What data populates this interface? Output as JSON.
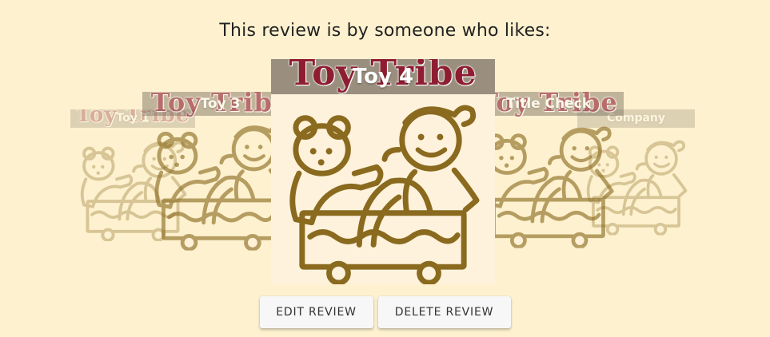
{
  "heading": "This review is by someone who likes:",
  "brand_logo_text": "Toy Tribe",
  "cards": {
    "far_left": {
      "title": "Toy 1"
    },
    "left": {
      "title": "Toy 3"
    },
    "center": {
      "title": "Toy 4"
    },
    "right": {
      "title": "Title Check"
    },
    "far_right": {
      "title": "Company"
    }
  },
  "buttons": {
    "edit": "EDIT REVIEW",
    "delete": "DELETE REVIEW"
  },
  "colors": {
    "background": "#fdf1cf",
    "toy_icon": "#8a6a1e",
    "logo": "#8e1d31"
  },
  "icons": {
    "toy_art": "toy-wagon-icon"
  }
}
